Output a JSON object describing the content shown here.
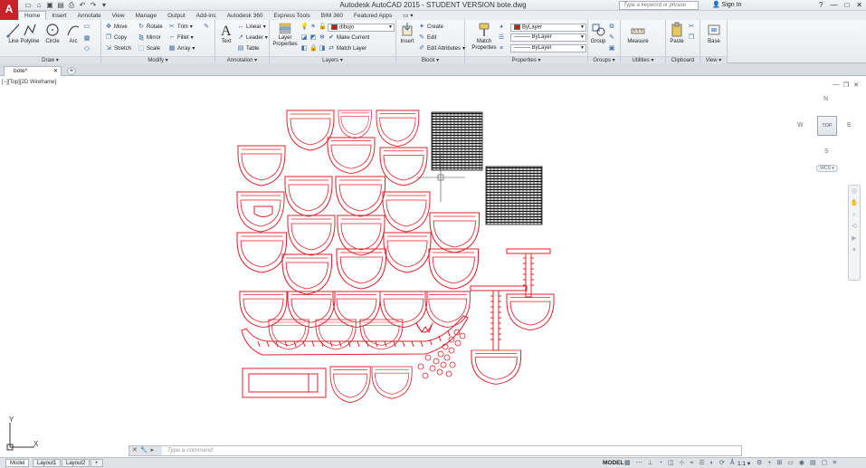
{
  "app": {
    "logo": "A",
    "title": "Autodesk AutoCAD 2015 - STUDENT VERSION    bote.dwg",
    "search_placeholder": "Type a keyword or phrase",
    "sign_in": "Sign In",
    "accent": "#c8232b"
  },
  "qat": [
    "new-icon",
    "open-icon",
    "save-icon",
    "saveas-icon",
    "print-icon",
    "undo-icon",
    "redo-icon",
    "dropdown-icon"
  ],
  "tabs": [
    "Home",
    "Insert",
    "Annotate",
    "View",
    "Manage",
    "Output",
    "Add-ins",
    "Autodesk 360",
    "Express Tools",
    "BIM 360",
    "Featured Apps"
  ],
  "draw": {
    "title": "Draw",
    "items": [
      "Line",
      "Polyline",
      "Circle",
      "Arc"
    ]
  },
  "modify": {
    "title": "Modify",
    "items": [
      "Move",
      "Rotate",
      "Trim",
      "Copy",
      "Mirror",
      "Fillet",
      "Stretch",
      "Scale",
      "Array"
    ]
  },
  "annotation": {
    "title": "Annotation",
    "text": "Text",
    "items": [
      "Linear",
      "Leader",
      "Table"
    ]
  },
  "layers": {
    "title": "Layers",
    "properties": "Layer Properties",
    "current_layer": "dibujo",
    "layer_color": "#e01010",
    "items": [
      "Make Current",
      "Match Layer"
    ]
  },
  "block": {
    "title": "Block",
    "insert": "Insert",
    "items": [
      "Create",
      "Edit",
      "Edit Attributes"
    ]
  },
  "properties": {
    "title": "Properties",
    "match": "Match Properties",
    "color": "ByLayer",
    "linetype": "ByLayer",
    "lineweight": "ByLayer"
  },
  "groups": {
    "title": "Groups",
    "group": "Group"
  },
  "utilities": {
    "title": "Utilities",
    "measure": "Measure"
  },
  "clipboard": {
    "title": "Clipboard",
    "paste": "Paste"
  },
  "view": {
    "title": "View",
    "base": "Base"
  },
  "document": {
    "tab": "bote*",
    "viewport_label": "[−][Top][2D Wireframe]"
  },
  "viewcube": {
    "n": "N",
    "s": "S",
    "e": "E",
    "w": "W",
    "face": "TOP",
    "wcs": "WCS"
  },
  "ucs": {
    "x": "X",
    "y": "Y"
  },
  "command": {
    "placeholder": "Type a command"
  },
  "status": {
    "layouts": [
      "Model",
      "Layout1",
      "Layout2"
    ],
    "model": "MODEL",
    "scale": "1:1"
  },
  "drawing_color": "#e0202a"
}
